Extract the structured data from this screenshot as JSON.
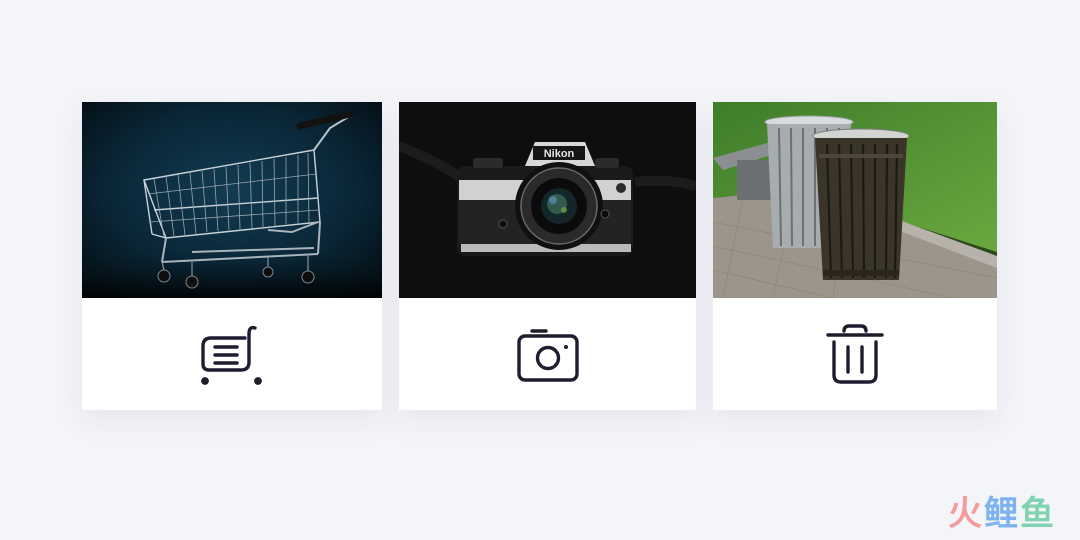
{
  "cards": [
    {
      "photo": "shopping-cart-photo",
      "icon": "shopping-cart-icon",
      "camera_brand": ""
    },
    {
      "photo": "camera-photo",
      "icon": "camera-icon",
      "camera_brand": "Nikon"
    },
    {
      "photo": "trash-bins-photo",
      "icon": "trash-icon",
      "camera_brand": ""
    }
  ],
  "watermark": {
    "chars": [
      "火",
      "鲤",
      "鱼"
    ],
    "colors": [
      "#f39b9e",
      "#7fb2f0",
      "#7fd3b0"
    ]
  },
  "colors": {
    "background": "#f4f5f9",
    "icon_stroke": "#1f1c2e",
    "card": "#ffffff"
  }
}
